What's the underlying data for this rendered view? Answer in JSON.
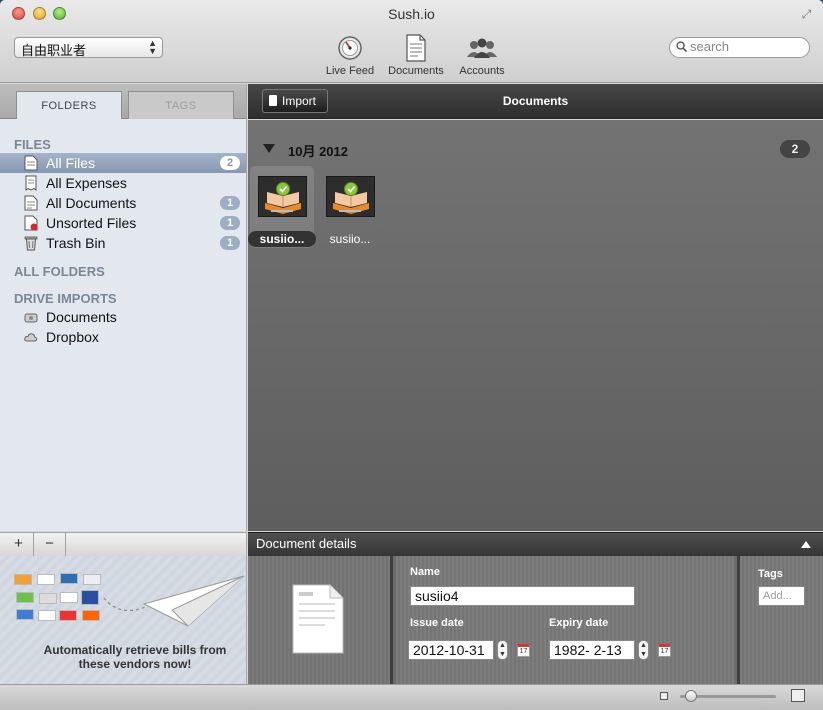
{
  "window": {
    "title": "Sush.io"
  },
  "toolbar": {
    "account": "自由职业者",
    "buttons": [
      {
        "label": "Live Feed",
        "icon": "live-feed-icon"
      },
      {
        "label": "Documents",
        "icon": "documents-icon"
      },
      {
        "label": "Accounts",
        "icon": "accounts-icon"
      }
    ],
    "search_placeholder": "search"
  },
  "sidebar": {
    "tabs": [
      "FOLDERS",
      "TAGS"
    ],
    "sections": {
      "files": "FILES",
      "all_folders": "ALL FOLDERS",
      "drive_imports": "DRIVE IMPORTS"
    },
    "files": [
      {
        "label": "All Files",
        "count": "2",
        "selected": true
      },
      {
        "label": "All Expenses",
        "count": ""
      },
      {
        "label": "All Documents",
        "count": "1"
      },
      {
        "label": "Unsorted Files",
        "count": "1"
      },
      {
        "label": "Trash Bin",
        "count": "1"
      }
    ],
    "drives": [
      {
        "label": "Documents"
      },
      {
        "label": "Dropbox"
      }
    ],
    "footer": {
      "add": "+",
      "remove": "−"
    },
    "promo_text": "Automatically retrieve bills from these vendors now!"
  },
  "main": {
    "import_label": "Import",
    "title": "Documents",
    "group": {
      "label": "10月 2012",
      "count": "2"
    },
    "documents": [
      {
        "name": "susiio...",
        "selected": true
      },
      {
        "name": "susiio...",
        "selected": false
      }
    ]
  },
  "details": {
    "header": "Document details",
    "name_label": "Name",
    "name_value": "susiio4",
    "issue_label": "Issue date",
    "issue_value": "2012-10-31",
    "expiry_label": "Expiry date",
    "expiry_value": "1982-  2-13",
    "tags_label": "Tags",
    "tags_placeholder": "Add..."
  },
  "calendar_day": "17"
}
